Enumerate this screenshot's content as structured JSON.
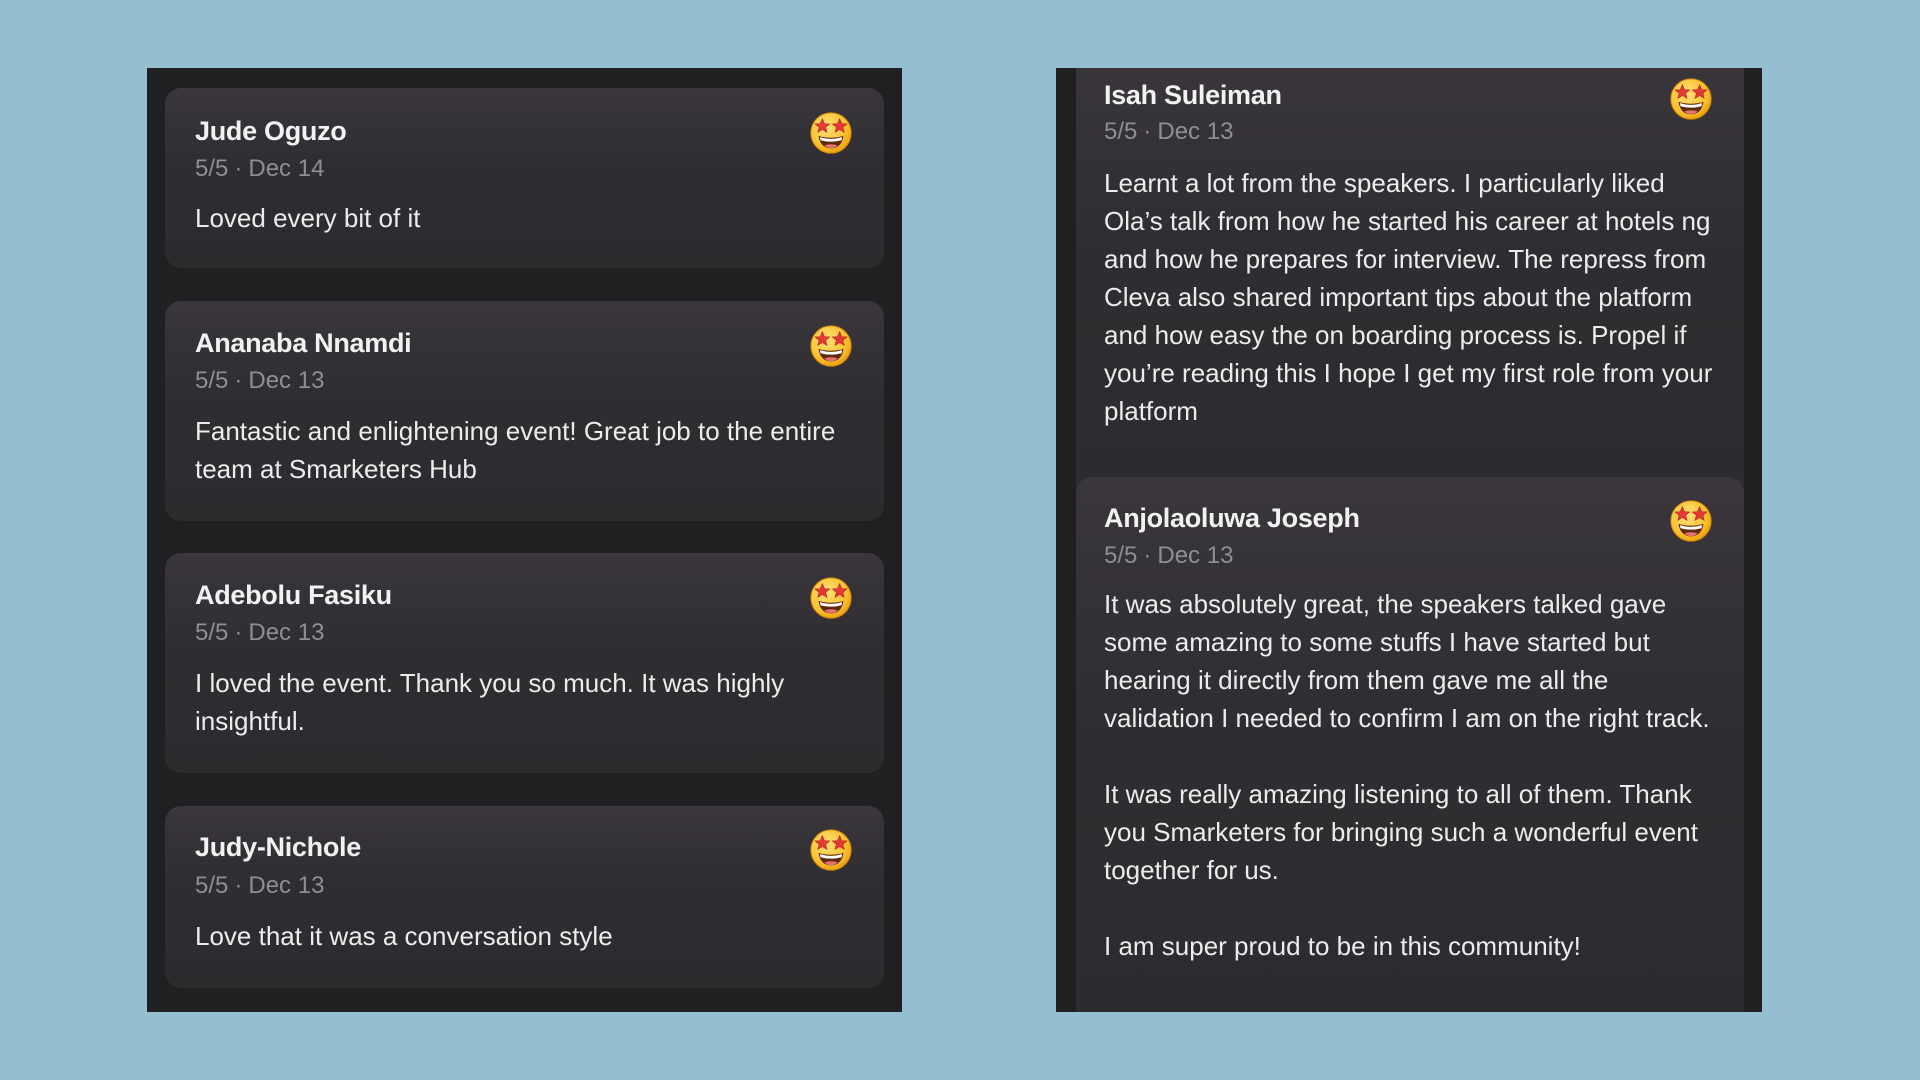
{
  "left_column": [
    {
      "name": "Jude Oguzo",
      "rating": "5/5",
      "date": "Dec 14",
      "text": "Loved every bit of it",
      "reaction_icon": "star-struck-emoji-icon"
    },
    {
      "name": "Ananaba Nnamdi",
      "rating": "5/5",
      "date": "Dec 13",
      "text": "Fantastic and enlightening event! Great job to the entire team at Smarketers Hub",
      "reaction_icon": "star-struck-emoji-icon"
    },
    {
      "name": "Adebolu Fasiku",
      "rating": "5/5",
      "date": "Dec 13",
      "text": "I loved the event. Thank you so much. It was highly insightful.",
      "reaction_icon": "star-struck-emoji-icon"
    },
    {
      "name": "Judy-Nichole",
      "rating": "5/5",
      "date": "Dec 13",
      "text": "Love that it was a conversation style",
      "reaction_icon": "star-struck-emoji-icon"
    }
  ],
  "right_column": [
    {
      "name": "Isah Suleiman",
      "rating": "5/5",
      "date": "Dec 13",
      "text": "Learnt a lot from the speakers. I particularly liked Ola’s talk from how he started his career at hotels ng and how he prepares for interview. The repress from Cleva also shared important tips about the platform and how easy the on boarding process is. Propel if you’re reading this I hope I get my first role from your platform",
      "reaction_icon": "star-struck-emoji-icon"
    },
    {
      "name": "Anjolaoluwa Joseph",
      "rating": "5/5",
      "date": "Dec 13",
      "text": "It was absolutely great, the speakers talked gave some amazing to some stuffs I have started but hearing it directly from them gave me all the validation I needed to confirm I am on the right track.\n\nIt was really amazing listening to all of them. Thank you Smarketers for bringing such a wonderful event together for us.\n\nI am super proud to be in this community!",
      "reaction_icon": "star-struck-emoji-icon"
    }
  ],
  "separator": "·",
  "colors": {
    "page_background": "#95bfd0",
    "panel_background": "#202023",
    "card_background": "#2e2d31",
    "name_text": "#f2f2f2",
    "meta_text": "#8e8e93",
    "body_text": "#ececec"
  }
}
